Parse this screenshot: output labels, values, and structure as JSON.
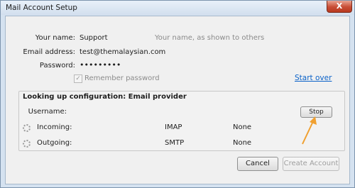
{
  "window": {
    "title": "Mail Account Setup",
    "close_glyph": "X"
  },
  "form": {
    "name_label": "Your name:",
    "name_value": "Support",
    "name_hint": "Your name, as shown to others",
    "email_label": "Email address:",
    "email_value": "test@themalaysian.com",
    "password_label": "Password:",
    "password_value": "•••••••••",
    "remember_label": "Remember password",
    "remember_checked": true,
    "start_over_label": "Start over"
  },
  "lookup": {
    "heading": "Looking up configuration: Email provider",
    "username_label": "Username:",
    "stop_label": "Stop",
    "incoming_label": "Incoming:",
    "incoming_protocol": "IMAP",
    "incoming_security": "None",
    "outgoing_label": "Outgoing:",
    "outgoing_protocol": "SMTP",
    "outgoing_security": "None"
  },
  "footer": {
    "cancel_label": "Cancel",
    "create_label": "Create Account"
  },
  "colors": {
    "annotation_arrow": "#f0a030",
    "link": "#0b62c8"
  }
}
